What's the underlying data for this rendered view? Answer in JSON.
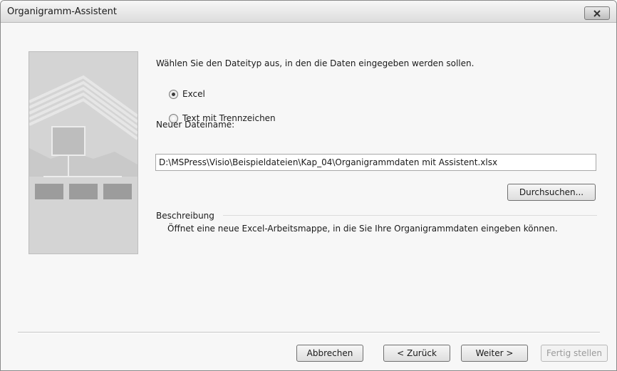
{
  "window": {
    "title": "Organigramm-Assistent"
  },
  "main": {
    "instruction": "Wählen Sie den Dateityp aus, in den die Daten eingegeben werden sollen.",
    "options": [
      {
        "label": "Excel",
        "selected": true
      },
      {
        "label": "Text mit Trennzeichen",
        "selected": false
      }
    ],
    "filename_label": "Neuer Dateiname:",
    "filename_value": "D:\\MSPress\\Visio\\Beispieldateien\\Kap_04\\Organigrammdaten mit Assistent.xlsx",
    "browse_label": "Durchsuchen...",
    "description_title": "Beschreibung",
    "description_text": "Öffnet eine neue Excel-Arbeitsmappe, in die Sie Ihre Organigrammdaten eingeben können."
  },
  "footer": {
    "cancel_label": "Abbrechen",
    "back_label": "< Zurück",
    "next_label": "Weiter >",
    "finish_label": "Fertig stellen"
  }
}
